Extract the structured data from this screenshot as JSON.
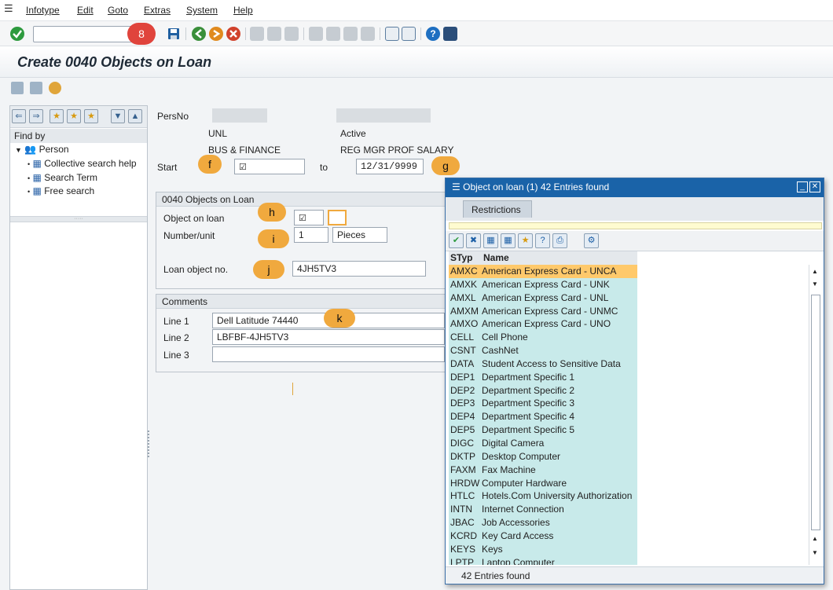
{
  "menu": {
    "items": [
      "Infotype",
      "Edit",
      "Goto",
      "Extras",
      "System",
      "Help"
    ]
  },
  "toolbar": {
    "command_value": "",
    "callout_8": "8"
  },
  "page": {
    "title": "Create 0040 Objects on Loan"
  },
  "nav": {
    "find_by": "Find by",
    "person": "Person",
    "items": [
      "Collective search help",
      "Search Term",
      "Free search"
    ]
  },
  "header": {
    "persno_label": "PersNo",
    "unl": "UNL",
    "active": "Active",
    "bus_finance": "BUS & FINANCE",
    "reg_mgr": "REG MGR PROF SALARY",
    "start_label": "Start",
    "to_label": "to",
    "end_date": "12/31/9999"
  },
  "loan_group": {
    "title": "0040 Objects on Loan",
    "object_label": "Object on loan",
    "number_label": "Number/unit",
    "number_value": "1",
    "unit_value": "Pieces",
    "loan_no_label": "Loan object no.",
    "loan_no_value": "4JH5TV3"
  },
  "comments": {
    "title": "Comments",
    "line1_label": "Line 1",
    "line1_value": "Dell Latitude 74440",
    "line2_label": "Line 2",
    "line2_value": "LBFBF-4JH5TV3",
    "line3_label": "Line 3",
    "line3_value": ""
  },
  "callouts": {
    "f": "f",
    "g": "g",
    "h": "h",
    "i": "i",
    "j": "j",
    "k": "k"
  },
  "popup": {
    "title": "Object on loan (1)   42 Entries found",
    "tab": "Restrictions",
    "col_styp": "STyp",
    "col_name": "Name",
    "status": "42 Entries found",
    "rows": [
      {
        "code": "AMXC",
        "name": "American Express Card - UNCA"
      },
      {
        "code": "AMXK",
        "name": "American Express Card - UNK"
      },
      {
        "code": "AMXL",
        "name": "American Express Card - UNL"
      },
      {
        "code": "AMXM",
        "name": "American Express Card - UNMC"
      },
      {
        "code": "AMXO",
        "name": "American Express Card - UNO"
      },
      {
        "code": "CELL",
        "name": "Cell Phone"
      },
      {
        "code": "CSNT",
        "name": "CashNet"
      },
      {
        "code": "DATA",
        "name": "Student Access to Sensitive Data"
      },
      {
        "code": "DEP1",
        "name": "Department Specific 1"
      },
      {
        "code": "DEP2",
        "name": "Department Specific 2"
      },
      {
        "code": "DEP3",
        "name": "Department Specific 3"
      },
      {
        "code": "DEP4",
        "name": "Department Specific 4"
      },
      {
        "code": "DEP5",
        "name": "Department Specific 5"
      },
      {
        "code": "DIGC",
        "name": "Digital Camera"
      },
      {
        "code": "DKTP",
        "name": "Desktop Computer"
      },
      {
        "code": "FAXM",
        "name": "Fax Machine"
      },
      {
        "code": "HRDW",
        "name": "Computer Hardware"
      },
      {
        "code": "HTLC",
        "name": "Hotels.Com University Authorization"
      },
      {
        "code": "INTN",
        "name": "Internet Connection"
      },
      {
        "code": "JBAC",
        "name": "Job Accessories"
      },
      {
        "code": "KCRD",
        "name": "Key Card Access"
      },
      {
        "code": "KEYS",
        "name": "Keys"
      },
      {
        "code": "LPTP",
        "name": "Laptop Computer"
      }
    ]
  }
}
